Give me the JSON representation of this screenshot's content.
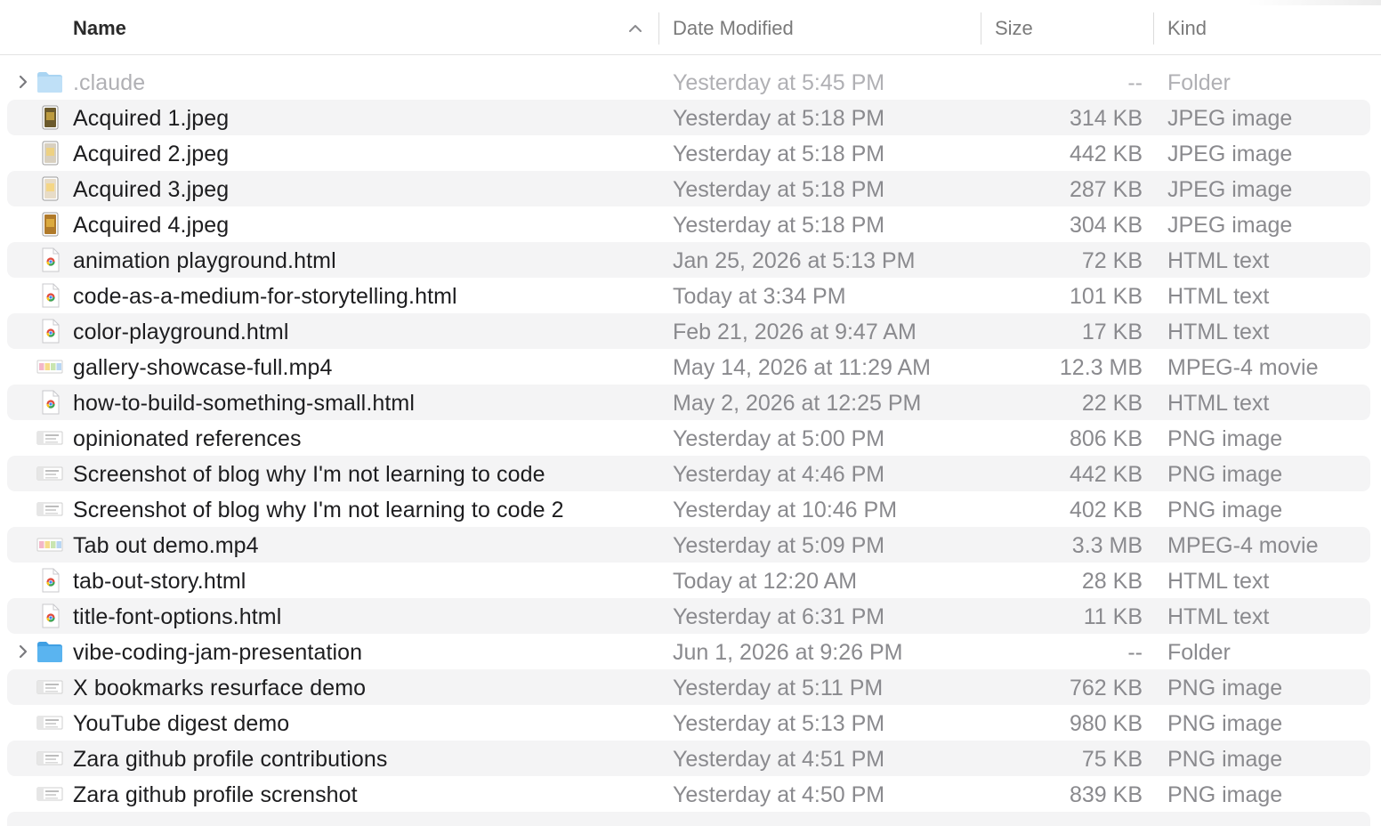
{
  "columns": {
    "name": "Name",
    "date": "Date Modified",
    "size": "Size",
    "kind": "Kind"
  },
  "files": [
    {
      "name": ".claude",
      "date": "Yesterday at 5:45 PM",
      "size": "--",
      "kind": "Folder",
      "icon": "folder-icon",
      "folder": true,
      "dim": true
    },
    {
      "name": "Acquired 1.jpeg",
      "date": "Yesterday at 5:18 PM",
      "size": "314 KB",
      "kind": "JPEG image",
      "icon": "jpeg-thumbnail-icon"
    },
    {
      "name": "Acquired 2.jpeg",
      "date": "Yesterday at 5:18 PM",
      "size": "442 KB",
      "kind": "JPEG image",
      "icon": "jpeg-thumbnail-icon"
    },
    {
      "name": "Acquired 3.jpeg",
      "date": "Yesterday at 5:18 PM",
      "size": "287 KB",
      "kind": "JPEG image",
      "icon": "jpeg-thumbnail-icon"
    },
    {
      "name": "Acquired 4.jpeg",
      "date": "Yesterday at 5:18 PM",
      "size": "304 KB",
      "kind": "JPEG image",
      "icon": "jpeg-thumbnail-icon"
    },
    {
      "name": "animation playground.html",
      "date": "Jan 25, 2026 at 5:13 PM",
      "size": "72 KB",
      "kind": "HTML text",
      "icon": "html-document-icon"
    },
    {
      "name": "code-as-a-medium-for-storytelling.html",
      "date": "Today at 3:34 PM",
      "size": "101 KB",
      "kind": "HTML text",
      "icon": "html-document-icon"
    },
    {
      "name": "color-playground.html",
      "date": "Feb 21, 2026 at 9:47 AM",
      "size": "17 KB",
      "kind": "HTML text",
      "icon": "html-document-icon"
    },
    {
      "name": "gallery-showcase-full.mp4",
      "date": "May 14, 2026 at 11:29 AM",
      "size": "12.3 MB",
      "kind": "MPEG-4 movie",
      "icon": "video-thumbnail-icon"
    },
    {
      "name": "how-to-build-something-small.html",
      "date": "May 2, 2026 at 12:25 PM",
      "size": "22 KB",
      "kind": "HTML text",
      "icon": "html-document-icon"
    },
    {
      "name": "opinionated references",
      "date": "Yesterday at 5:00 PM",
      "size": "806 KB",
      "kind": "PNG image",
      "icon": "png-thumbnail-icon"
    },
    {
      "name": "Screenshot of blog why I'm not learning to code",
      "date": "Yesterday at 4:46 PM",
      "size": "442 KB",
      "kind": "PNG image",
      "icon": "png-thumbnail-icon"
    },
    {
      "name": "Screenshot of blog why I'm not learning to code 2",
      "date": "Yesterday at 10:46 PM",
      "size": "402 KB",
      "kind": "PNG image",
      "icon": "png-thumbnail-icon"
    },
    {
      "name": "Tab out demo.mp4",
      "date": "Yesterday at 5:09 PM",
      "size": "3.3 MB",
      "kind": "MPEG-4 movie",
      "icon": "video-thumbnail-icon"
    },
    {
      "name": "tab-out-story.html",
      "date": "Today at 12:20 AM",
      "size": "28 KB",
      "kind": "HTML text",
      "icon": "html-document-icon"
    },
    {
      "name": "title-font-options.html",
      "date": "Yesterday at 6:31 PM",
      "size": "11 KB",
      "kind": "HTML text",
      "icon": "html-document-icon"
    },
    {
      "name": "vibe-coding-jam-presentation",
      "date": "Jun 1, 2026 at 9:26 PM",
      "size": "--",
      "kind": "Folder",
      "icon": "folder-icon",
      "folder": true
    },
    {
      "name": "X bookmarks resurface demo",
      "date": "Yesterday at 5:11 PM",
      "size": "762 KB",
      "kind": "PNG image",
      "icon": "png-thumbnail-icon"
    },
    {
      "name": "YouTube digest demo",
      "date": "Yesterday at 5:13 PM",
      "size": "980 KB",
      "kind": "PNG image",
      "icon": "png-thumbnail-icon"
    },
    {
      "name": "Zara github profile contributions",
      "date": "Yesterday at 4:51 PM",
      "size": "75 KB",
      "kind": "PNG image",
      "icon": "png-thumbnail-icon"
    },
    {
      "name": "Zara github profile screnshot",
      "date": "Yesterday at 4:50 PM",
      "size": "839 KB",
      "kind": "PNG image",
      "icon": "png-thumbnail-icon"
    }
  ],
  "colors": {
    "folder_blue": "#5ab4f0",
    "alt_row": "#f4f4f5",
    "secondary_text": "#8a8a8e"
  }
}
